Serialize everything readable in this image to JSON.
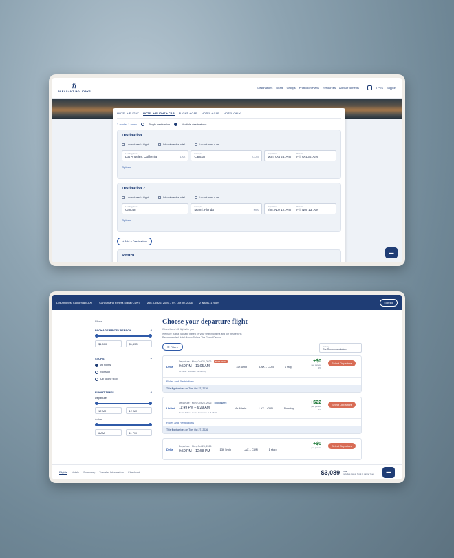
{
  "top": {
    "logo": "PLEASANT HOLIDAYS",
    "nav": [
      "Destinations",
      "Deals",
      "Groups",
      "Protection Plans",
      "Resources",
      "Advisor Benefits"
    ],
    "right": [
      "0 PTS",
      "Support"
    ],
    "tabs": [
      "HOTEL + FLIGHT",
      "HOTEL + FLIGHT + CAR",
      "FLIGHT + CAR",
      "HOTEL + CAR",
      "HOTEL ONLY"
    ],
    "travelers": "2 adults, 1 room",
    "single_dest": "Single destination",
    "multi_dest": "Multiple destinations",
    "dest1": {
      "title": "Destination 1",
      "checks": [
        "I do not need a flight",
        "I do not need a hotel",
        "I do not need a car"
      ],
      "leaving_label": "Leaving from",
      "leaving": "Los Angeles, California",
      "leaving_code": "LAX",
      "going_label": "Going to",
      "going": "Cancun",
      "going_code": "CUN",
      "depart_label": "Departure",
      "depart": "Mon, Oct 26, Any",
      "return_label": "Return",
      "return": "Fri, Oct 30, Any"
    },
    "dest2": {
      "title": "Destination 2",
      "checks": [
        "I do not need a flight",
        "I do not need a hotel",
        "I do not need a car"
      ],
      "leaving_label": "Leaving from",
      "leaving": "Cancun",
      "going_label": "Going to",
      "going": "Miami, Florida",
      "going_code": "MIA",
      "depart_label": "Departure",
      "depart": "Thu, Nov 12, Any",
      "return_label": "Return",
      "return": "Fri, Nov 13, Any"
    },
    "options": "Options",
    "add_dest": "Add a Destination",
    "return_title": "Return"
  },
  "bottom": {
    "trip": [
      "Los Angeles, California (LAX)",
      "Cancun and Riviera Maya (CUN)",
      "Mon, Oct 26, 2026 – Fri, Oct 30, 2026",
      "2 adults, 1 room"
    ],
    "edit": "Edit trip",
    "filters_title": "Filters",
    "price_title": "PACKAGE PRICE / PERSON",
    "price_min": "$1,500",
    "price_max": "$1,650",
    "stops_title": "STOPS",
    "stops": [
      "All flights",
      "Nonstop",
      "Up to one stop"
    ],
    "times_title": "FLIGHT TIMES",
    "departure": "Departure",
    "dep_min": "12 AM",
    "dep_max": "12 AM",
    "arrival": "Arrival",
    "arr_min": "6 AM",
    "arr_max": "11 PM",
    "heading": "Choose your departure flight",
    "found": "We've found 40 flights for you",
    "built": "We have built a package based on your search criteria and our best efforts",
    "recommended": "Recommended Hotel: Moon Palace The Grand Cancun",
    "filters_btn": "Filters",
    "sort_label": "Sort by",
    "sort_val": "Our Recommendations",
    "flights": [
      {
        "airline": "Delta",
        "dep": "Departure",
        "date": "Mon, Oct 26, 2026",
        "badge": "BEST DEAL",
        "times": "9:59 PM – 11:05 AM",
        "duration": "11h 6min",
        "route": "LAX – CUN",
        "stops": "1 stop",
        "meta": "Air Blue · Stats lex · Economy",
        "layover": "15h min in FLL",
        "price": "+$0",
        "per": "per person",
        "pct": "0%"
      },
      {
        "airline": "United",
        "dep": "Departure",
        "date": "Mon, Oct 26, 2026",
        "badge": "QUICKEST",
        "times": "11:49 PM – 6:29 AM",
        "duration": "4h 40min",
        "route": "LAX – CUN",
        "stops": "Nonstop",
        "meta": "Seats Airline · Seat · Economy · UA 1616",
        "layover": "",
        "price": "+$22",
        "per": "per person",
        "pct": "0%"
      },
      {
        "airline": "Delta",
        "dep": "Departure",
        "date": "Mon, Oct 26, 2026",
        "badge": "",
        "times": "9:59 PM – 12:58 PM",
        "duration": "13h 5min",
        "route": "LAX – CUN",
        "stops": "1 stop",
        "meta": "",
        "layover": "",
        "price": "+$0",
        "per": "per person",
        "pct": ""
      }
    ],
    "rules": "Rules and Restrictions",
    "notes": [
      "This flight arrives on Tue, Oct 27, 2026",
      "This flight arrives on Tue, Oct 27, 2026"
    ],
    "select": "Select Departure",
    "steps": [
      "Flights",
      "Hotels",
      "Summary",
      "Traveler Information",
      "Checkout"
    ],
    "total": "$3,089",
    "total_label": "Total",
    "total_sub": "Includes taxes, flight & carrier fees"
  }
}
